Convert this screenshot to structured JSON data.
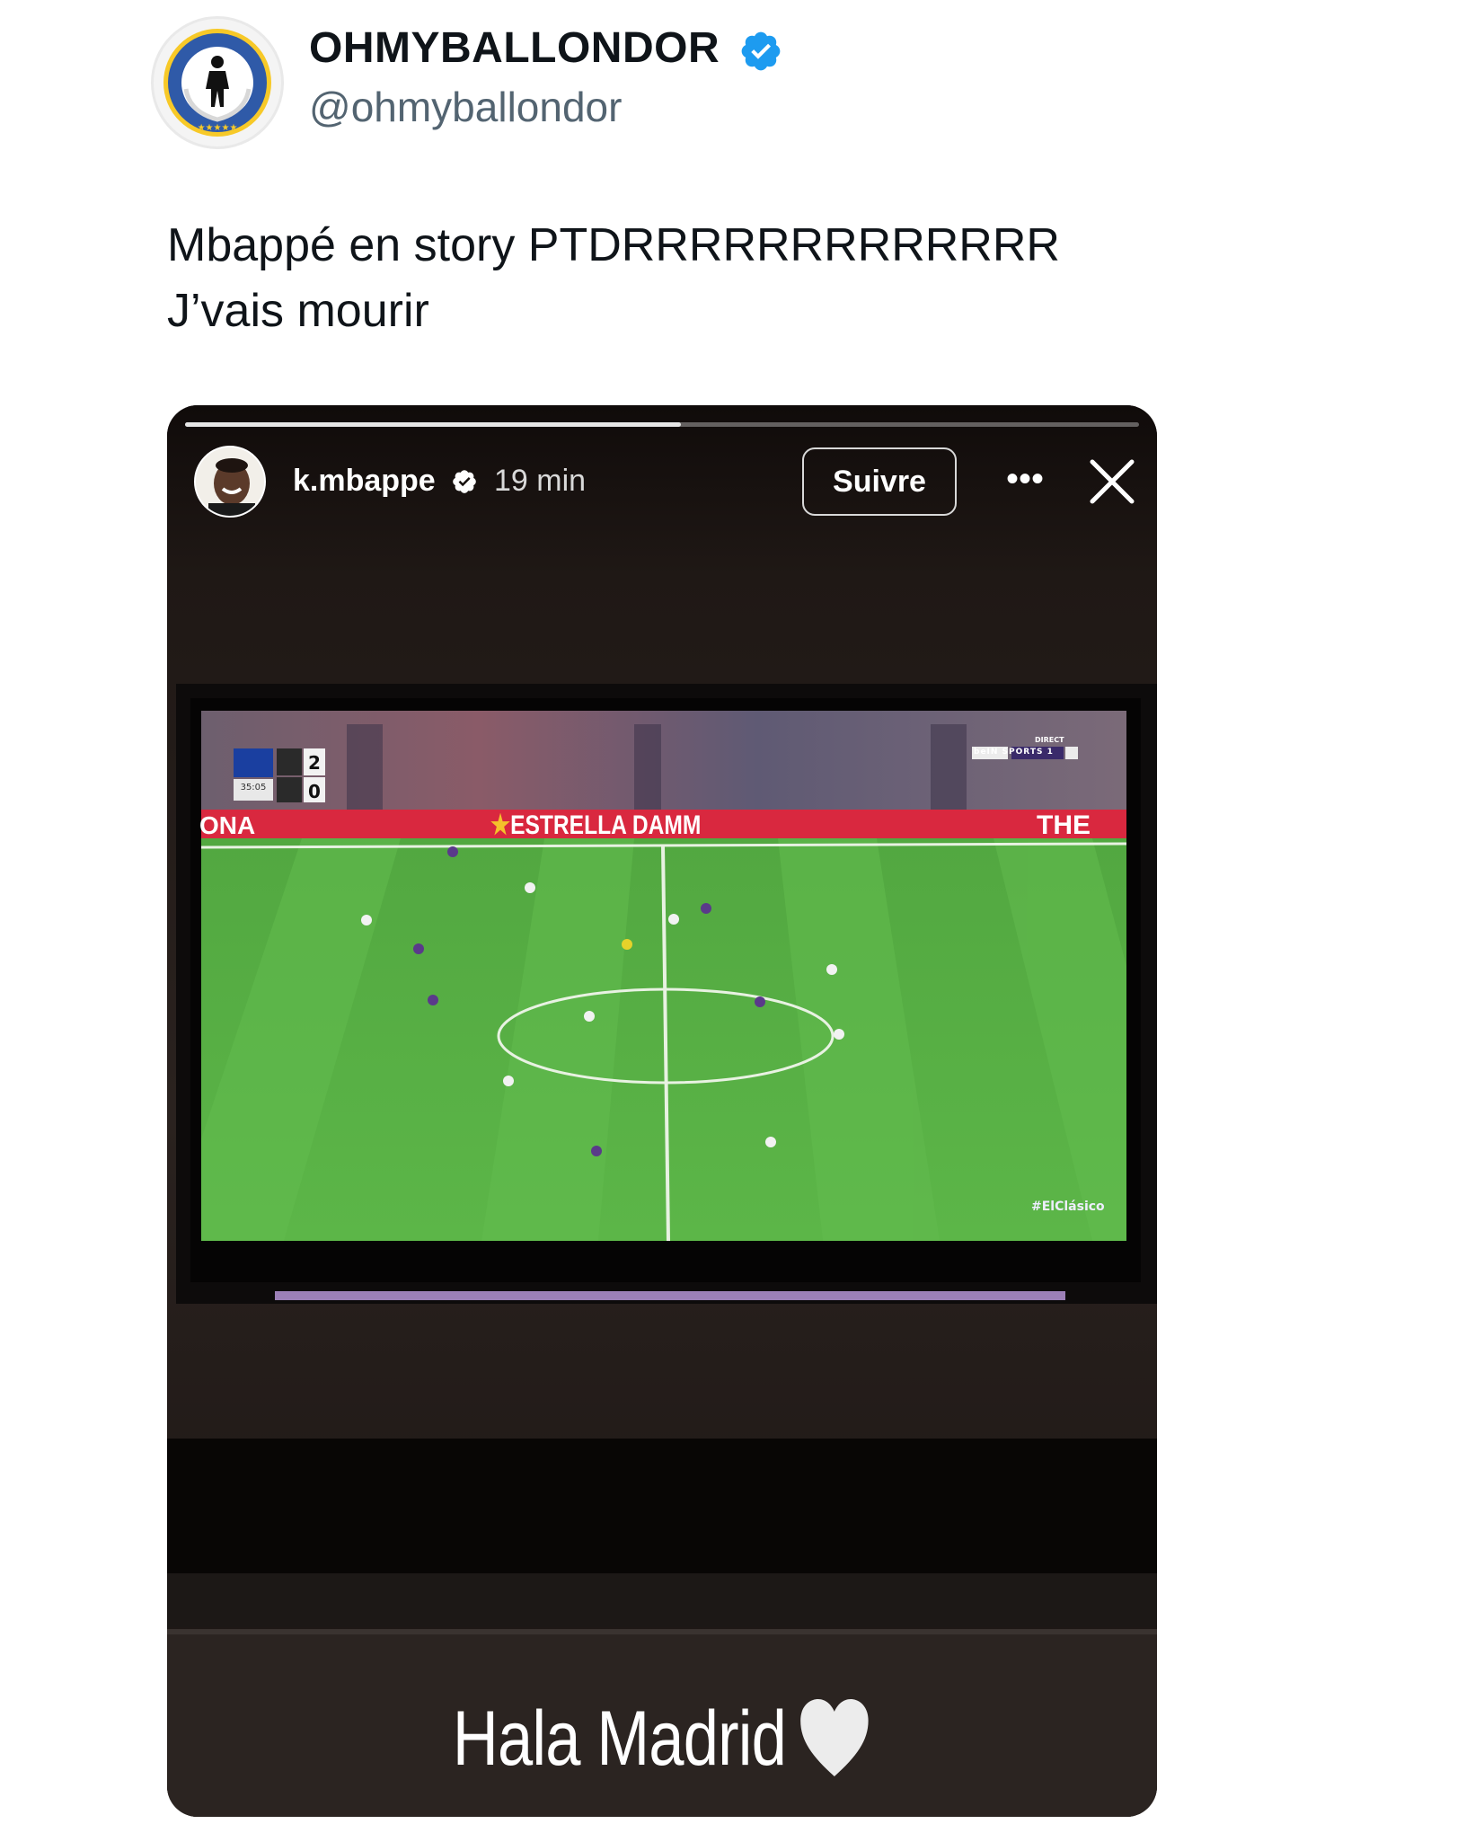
{
  "tweet": {
    "display_name": "OHMYBALLONDOR",
    "handle": "@ohmyballondor",
    "avatar_ring_text": "OH MY BALLON D'OR",
    "verified_color": "#1d9bf0",
    "text_lines": [
      "Mbappé en story PTDRRRRRRRRRRRRR",
      "J’vais mourir"
    ]
  },
  "story": {
    "progress": 0.52,
    "username": "k.mbappe",
    "time": "19 min",
    "follow_label": "Suivre",
    "more_icon": "more-horizontal-icon",
    "close_icon": "close-icon",
    "caption": "Hala Madrid",
    "caption_emoji": "white-heart",
    "tv": {
      "scoreboard": {
        "clock": "35:05",
        "home_score": "2",
        "away_score": "0"
      },
      "broadcaster": "beIN SPORTS 1",
      "live_tag": "DIRECT",
      "ad_banner_left": "ONA",
      "ad_banner_main": "ESTRELLA DAMM",
      "ad_banner_right": "THE",
      "hashtag": "#ElClásico"
    }
  }
}
